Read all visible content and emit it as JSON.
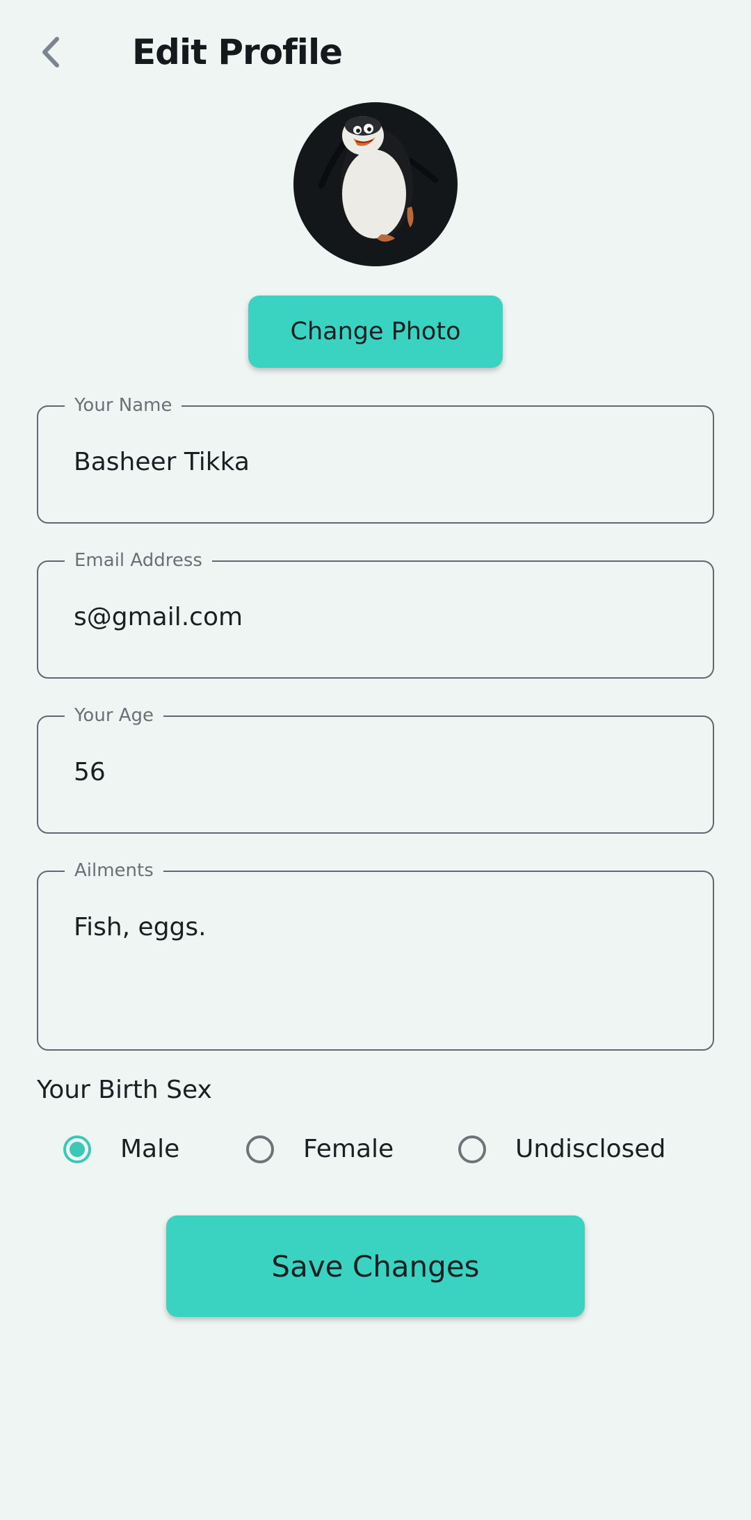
{
  "header": {
    "back_icon": "chevron-left-icon",
    "title": "Edit Profile"
  },
  "avatar": {
    "description_icon": "penguin-avatar"
  },
  "change_photo_label": "Change Photo",
  "fields": {
    "name": {
      "label": "Your Name",
      "value": "Basheer Tikka"
    },
    "email": {
      "label": "Email Address",
      "value": "s@gmail.com"
    },
    "age": {
      "label": "Your Age",
      "value": "56"
    },
    "ailments": {
      "label": "Ailments",
      "value": "Fish, eggs."
    }
  },
  "birth_sex": {
    "label": "Your Birth Sex",
    "options": [
      "Male",
      "Female",
      "Undisclosed"
    ],
    "selected": "Male"
  },
  "save_label": "Save Changes",
  "colors": {
    "background": "#eff5f2",
    "accent": "#3ad2c1",
    "outline": "#5f6770"
  }
}
